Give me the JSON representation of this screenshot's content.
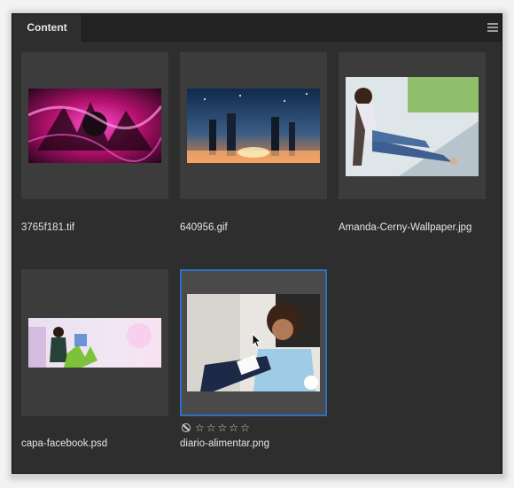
{
  "panel": {
    "tab_label": "Content"
  },
  "items": [
    {
      "filename": "3765f181.tif",
      "selected": false,
      "thumb_icon": "purple-anime-artwork"
    },
    {
      "filename": "640956.gif",
      "selected": false,
      "thumb_icon": "anime-night-city-artwork"
    },
    {
      "filename": "Amanda-Cerny-Wallpaper.jpg",
      "selected": false,
      "thumb_icon": "woman-sitting-photo"
    },
    {
      "filename": "capa-facebook.psd",
      "selected": false,
      "thumb_icon": "facebook-cover-collage"
    },
    {
      "filename": "diario-alimentar.png",
      "selected": true,
      "thumb_icon": "woman-writing-photo"
    }
  ],
  "rating": {
    "stars": 0,
    "max_stars": 5,
    "rejected_icon": "no-entry-icon"
  },
  "colors": {
    "panel_bg": "#2e2e2e",
    "thumb_bg": "#3c3c3c",
    "selection": "#2d6fc3",
    "text": "#e3e3e3"
  }
}
